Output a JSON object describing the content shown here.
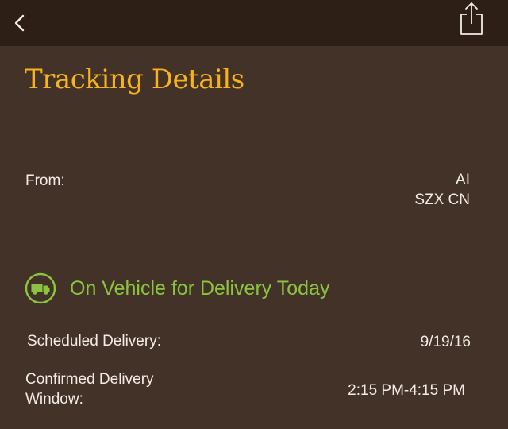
{
  "topbar": {
    "back_icon": "chevron-left-icon",
    "share_icon": "share-icon"
  },
  "page": {
    "title": "Tracking Details"
  },
  "shipment": {
    "from_label": "From:",
    "from_line1": "AI",
    "from_line2": "SZX CN"
  },
  "status": {
    "icon": "truck-icon",
    "text": "On Vehicle for Delivery Today",
    "color": "#8bc53f"
  },
  "delivery": {
    "scheduled_label": "Scheduled Delivery:",
    "scheduled_value": "9/19/16",
    "window_label_line1": "Confirmed Delivery",
    "window_label_line2": "Window:",
    "window_value": "2:15 PM-4:15 PM"
  },
  "colors": {
    "background": "#433228",
    "topbar": "#2d1f16",
    "title": "#f7b21c"
  }
}
